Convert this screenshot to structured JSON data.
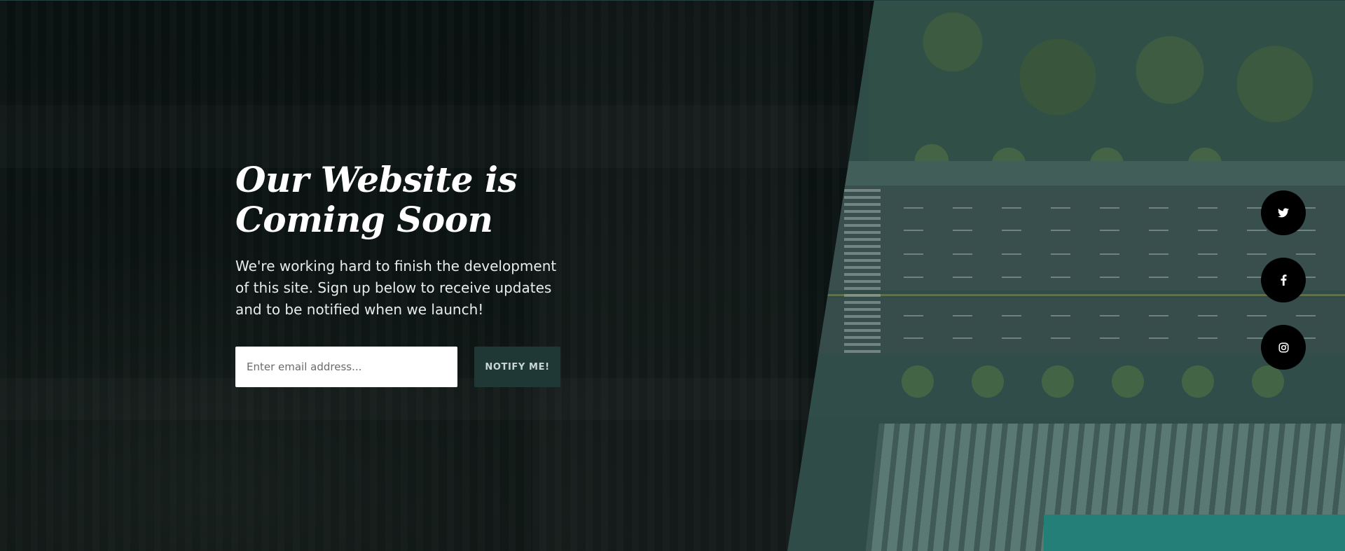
{
  "hero": {
    "headline_line1": "Our Website is",
    "headline_line2": "Coming Soon",
    "description": "We're working hard to finish the development of this site. Sign up below to receive updates and to be notified when we launch!"
  },
  "signup": {
    "email_placeholder": "Enter email address...",
    "button_label": "NOTIFY ME!"
  },
  "social": [
    {
      "icon": "twitter-icon"
    },
    {
      "icon": "facebook-icon"
    },
    {
      "icon": "instagram-icon"
    }
  ],
  "colors": {
    "background": "#0b1211",
    "button_bg": "#1f3836",
    "social_bg": "#000000",
    "text": "#ffffff"
  }
}
